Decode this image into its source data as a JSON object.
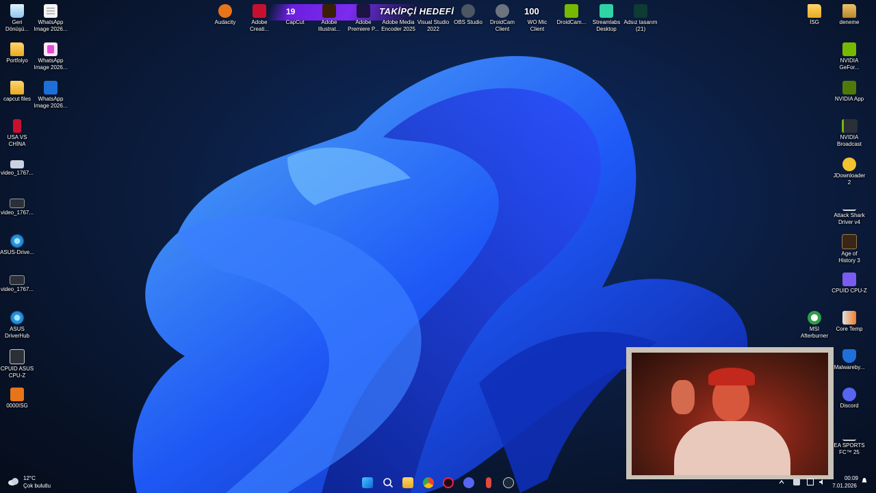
{
  "overlay": {
    "follower_count": "19",
    "follower_goal_title": "TAKİPÇİ HEDEFİ",
    "goal_target": "100"
  },
  "desktop_left": [
    {
      "label": "Geri\nDönüşü...",
      "icon": "recycle-bin-icon"
    },
    {
      "label": "WhatsApp\nImage 2026...",
      "icon": "image-file-icon"
    },
    {
      "label": "Portfolyo",
      "icon": "folder-icon"
    },
    {
      "label": "WhatsApp\nImage 2026...",
      "icon": "image-file-icon"
    },
    {
      "label": "capcut files",
      "icon": "folder-icon"
    },
    {
      "label": "WhatsApp\nImage 2026...",
      "icon": "image-file-icon"
    },
    {
      "label": "USA VS\nCHİNA",
      "icon": "image-file-icon"
    },
    {
      "label": "video_1767...",
      "icon": "video-file-icon"
    },
    {
      "label": "video_1767...",
      "icon": "video-file-icon"
    },
    {
      "label": "ASUS-Drive...",
      "icon": "asus-gear-icon"
    },
    {
      "label": "video_1767...",
      "icon": "video-file-icon"
    },
    {
      "label": "ASUS\nDriverHub",
      "icon": "asus-gear-icon"
    },
    {
      "label": "CPUID ASUS\nCPU-Z",
      "icon": "cpu-z-icon"
    },
    {
      "label": "0000ISG",
      "icon": "archive-icon"
    }
  ],
  "desktop_top": [
    {
      "label": "Audacity",
      "icon": "audacity-icon"
    },
    {
      "label": "Adobe\nCreati...",
      "icon": "adobe-creative-cloud-icon"
    },
    {
      "label": "CapCut",
      "icon": "capcut-icon"
    },
    {
      "label": "Adobe\nIllustrat...",
      "icon": "adobe-illustrator-icon"
    },
    {
      "label": "Adobe\nPremiere P...",
      "icon": "adobe-premiere-icon"
    },
    {
      "label": "Adobe Media\nEncoder 2025",
      "icon": "adobe-media-encoder-icon"
    },
    {
      "label": "Visual Studio\n2022",
      "icon": "visual-studio-icon"
    },
    {
      "label": "OBS Studio",
      "icon": "obs-icon"
    },
    {
      "label": "DroidCam\nClient",
      "icon": "droidcam-icon"
    },
    {
      "label": "WO Mic\nClient",
      "icon": "wo-mic-icon"
    },
    {
      "label": "DroidCam...",
      "icon": "droidcam-icon"
    },
    {
      "label": "Streamlabs\nDesktop",
      "icon": "streamlabs-icon"
    },
    {
      "label": "Adsız tasarım\n(21)",
      "icon": "canva-design-icon"
    }
  ],
  "desktop_right": [
    {
      "label": "İSG",
      "icon": "folder-icon"
    },
    {
      "label": "deneme",
      "icon": "folder-icon"
    },
    {
      "label": "NVIDIA\nGeFor...",
      "icon": "nvidia-icon"
    },
    {
      "label": "NVIDIA App",
      "icon": "nvidia-icon"
    },
    {
      "label": "NVIDIA\nBroadcast",
      "icon": "nvidia-broadcast-icon"
    },
    {
      "label": "JDownloader\n2",
      "icon": "jdownloader-icon"
    },
    {
      "label": "Attack Shark\nDriver v4",
      "icon": "attack-shark-icon"
    },
    {
      "label": "Age of\nHistory 3",
      "icon": "age-of-history-icon"
    },
    {
      "label": "CPUID CPU-Z",
      "icon": "cpu-z-icon"
    },
    {
      "label": "MSI\nAfterburner",
      "icon": "msi-afterburner-icon"
    },
    {
      "label": "Core Temp",
      "icon": "core-temp-icon"
    },
    {
      "label": "Malwareby...",
      "icon": "malwarebytes-icon"
    },
    {
      "label": "Discord",
      "icon": "discord-icon"
    },
    {
      "label": "EA SPORTS\nFC™ 25",
      "icon": "ea-sports-fc-icon"
    }
  ],
  "taskbar": {
    "weather_temp": "12°C",
    "weather_desc": "Çok bulutlu",
    "time": "00:09",
    "date": "7.01.2026",
    "apps": [
      "start-icon",
      "search-icon",
      "file-explorer-icon",
      "chrome-icon",
      "opera-gx-icon",
      "discord-icon",
      "microphone-icon",
      "steam-icon"
    ]
  }
}
